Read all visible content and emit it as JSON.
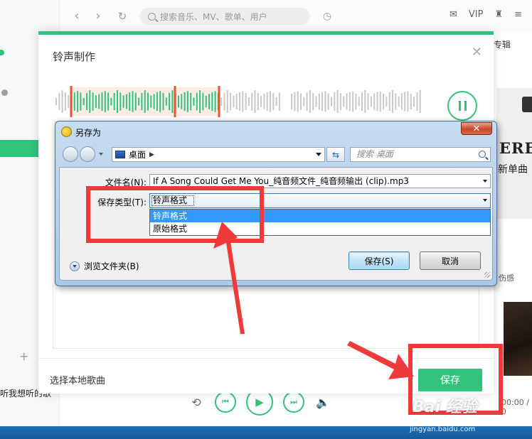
{
  "app": {
    "search_placeholder": "搜索音乐、MV、歌单、用户",
    "vip_label": "VIP",
    "album_tab": "专辑",
    "album_art_text": "ERE",
    "album_art_text2": "新单曲",
    "side_label": "伤感",
    "bottom_left_text": "听我想听的歌",
    "time_text": "00:00 / 0",
    "plus": "+"
  },
  "ringtone_dialog": {
    "title": "铃声制作",
    "choose_local": "选择本地歌曲",
    "save_button": "保存"
  },
  "save_as_dialog": {
    "title": "另存为",
    "path_location": "桌面",
    "search_placeholder": "搜索 桌面",
    "filename_label": "文件名(N):",
    "filename_value": "If A Song Could Get Me You_纯音频文件_纯音频输出 (clip).mp3",
    "type_label": "保存类型(T):",
    "type_value": "铃声格式",
    "type_options": [
      "铃声格式",
      "原始格式"
    ],
    "browse_folders": "浏览文件夹(B)",
    "save_button": "保存(S)",
    "cancel_button": "取消"
  },
  "watermark": {
    "title": "Bai 经验",
    "url": "jingyan.baidu.com"
  },
  "colors": {
    "brand_green": "#31c27c",
    "annotation_red": "#ee3a3a",
    "selection_blue": "#3399ff"
  }
}
